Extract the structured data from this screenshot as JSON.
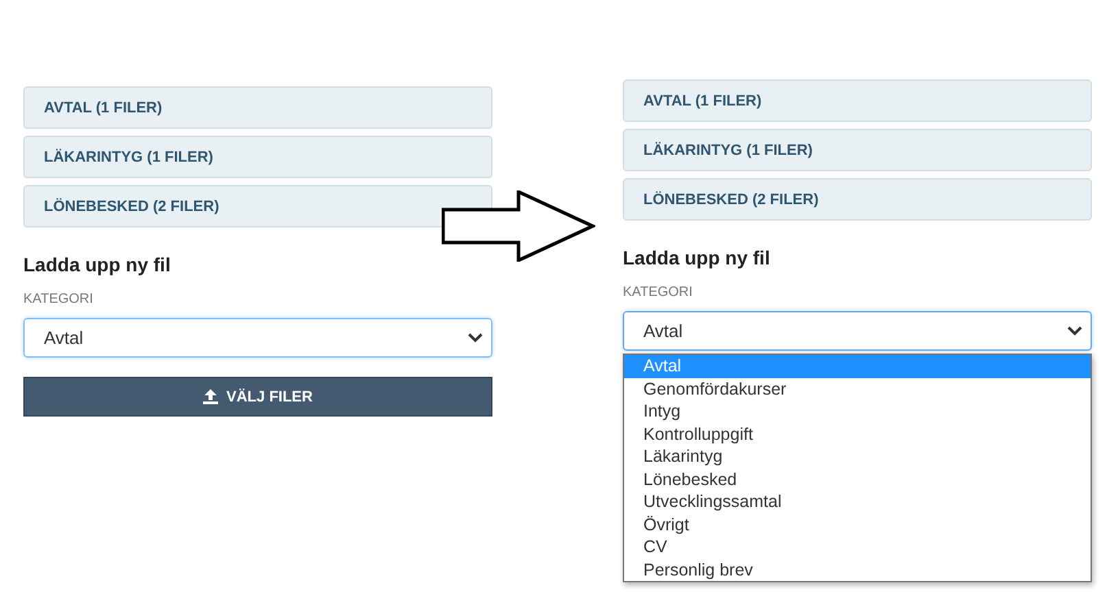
{
  "panels": [
    {
      "sections": [
        "AVTAL (1 FILER)",
        "LÄKARINTYG (1 FILER)",
        "LÖNEBESKED (2 FILER)"
      ],
      "heading": "Ladda upp ny fil",
      "category_label": "KATEGORI",
      "select_value": "Avtal",
      "expanded": false,
      "button": "VÄLJ FILER"
    },
    {
      "sections": [
        "AVTAL (1 FILER)",
        "LÄKARINTYG (1 FILER)",
        "LÖNEBESKED (2 FILER)"
      ],
      "heading": "Ladda upp ny fil",
      "category_label": "KATEGORI",
      "select_value": "Avtal",
      "expanded": true,
      "options": [
        {
          "label": "Avtal",
          "selected": true
        },
        {
          "label": "Genomfördakurser",
          "selected": false
        },
        {
          "label": "Intyg",
          "selected": false
        },
        {
          "label": "Kontrolluppgift",
          "selected": false
        },
        {
          "label": "Läkarintyg",
          "selected": false
        },
        {
          "label": "Lönebesked",
          "selected": false
        },
        {
          "label": "Utvecklingssamtal",
          "selected": false
        },
        {
          "label": "Övrigt",
          "selected": false
        },
        {
          "label": "CV",
          "selected": false
        },
        {
          "label": "Personlig brev",
          "selected": false
        }
      ]
    }
  ]
}
